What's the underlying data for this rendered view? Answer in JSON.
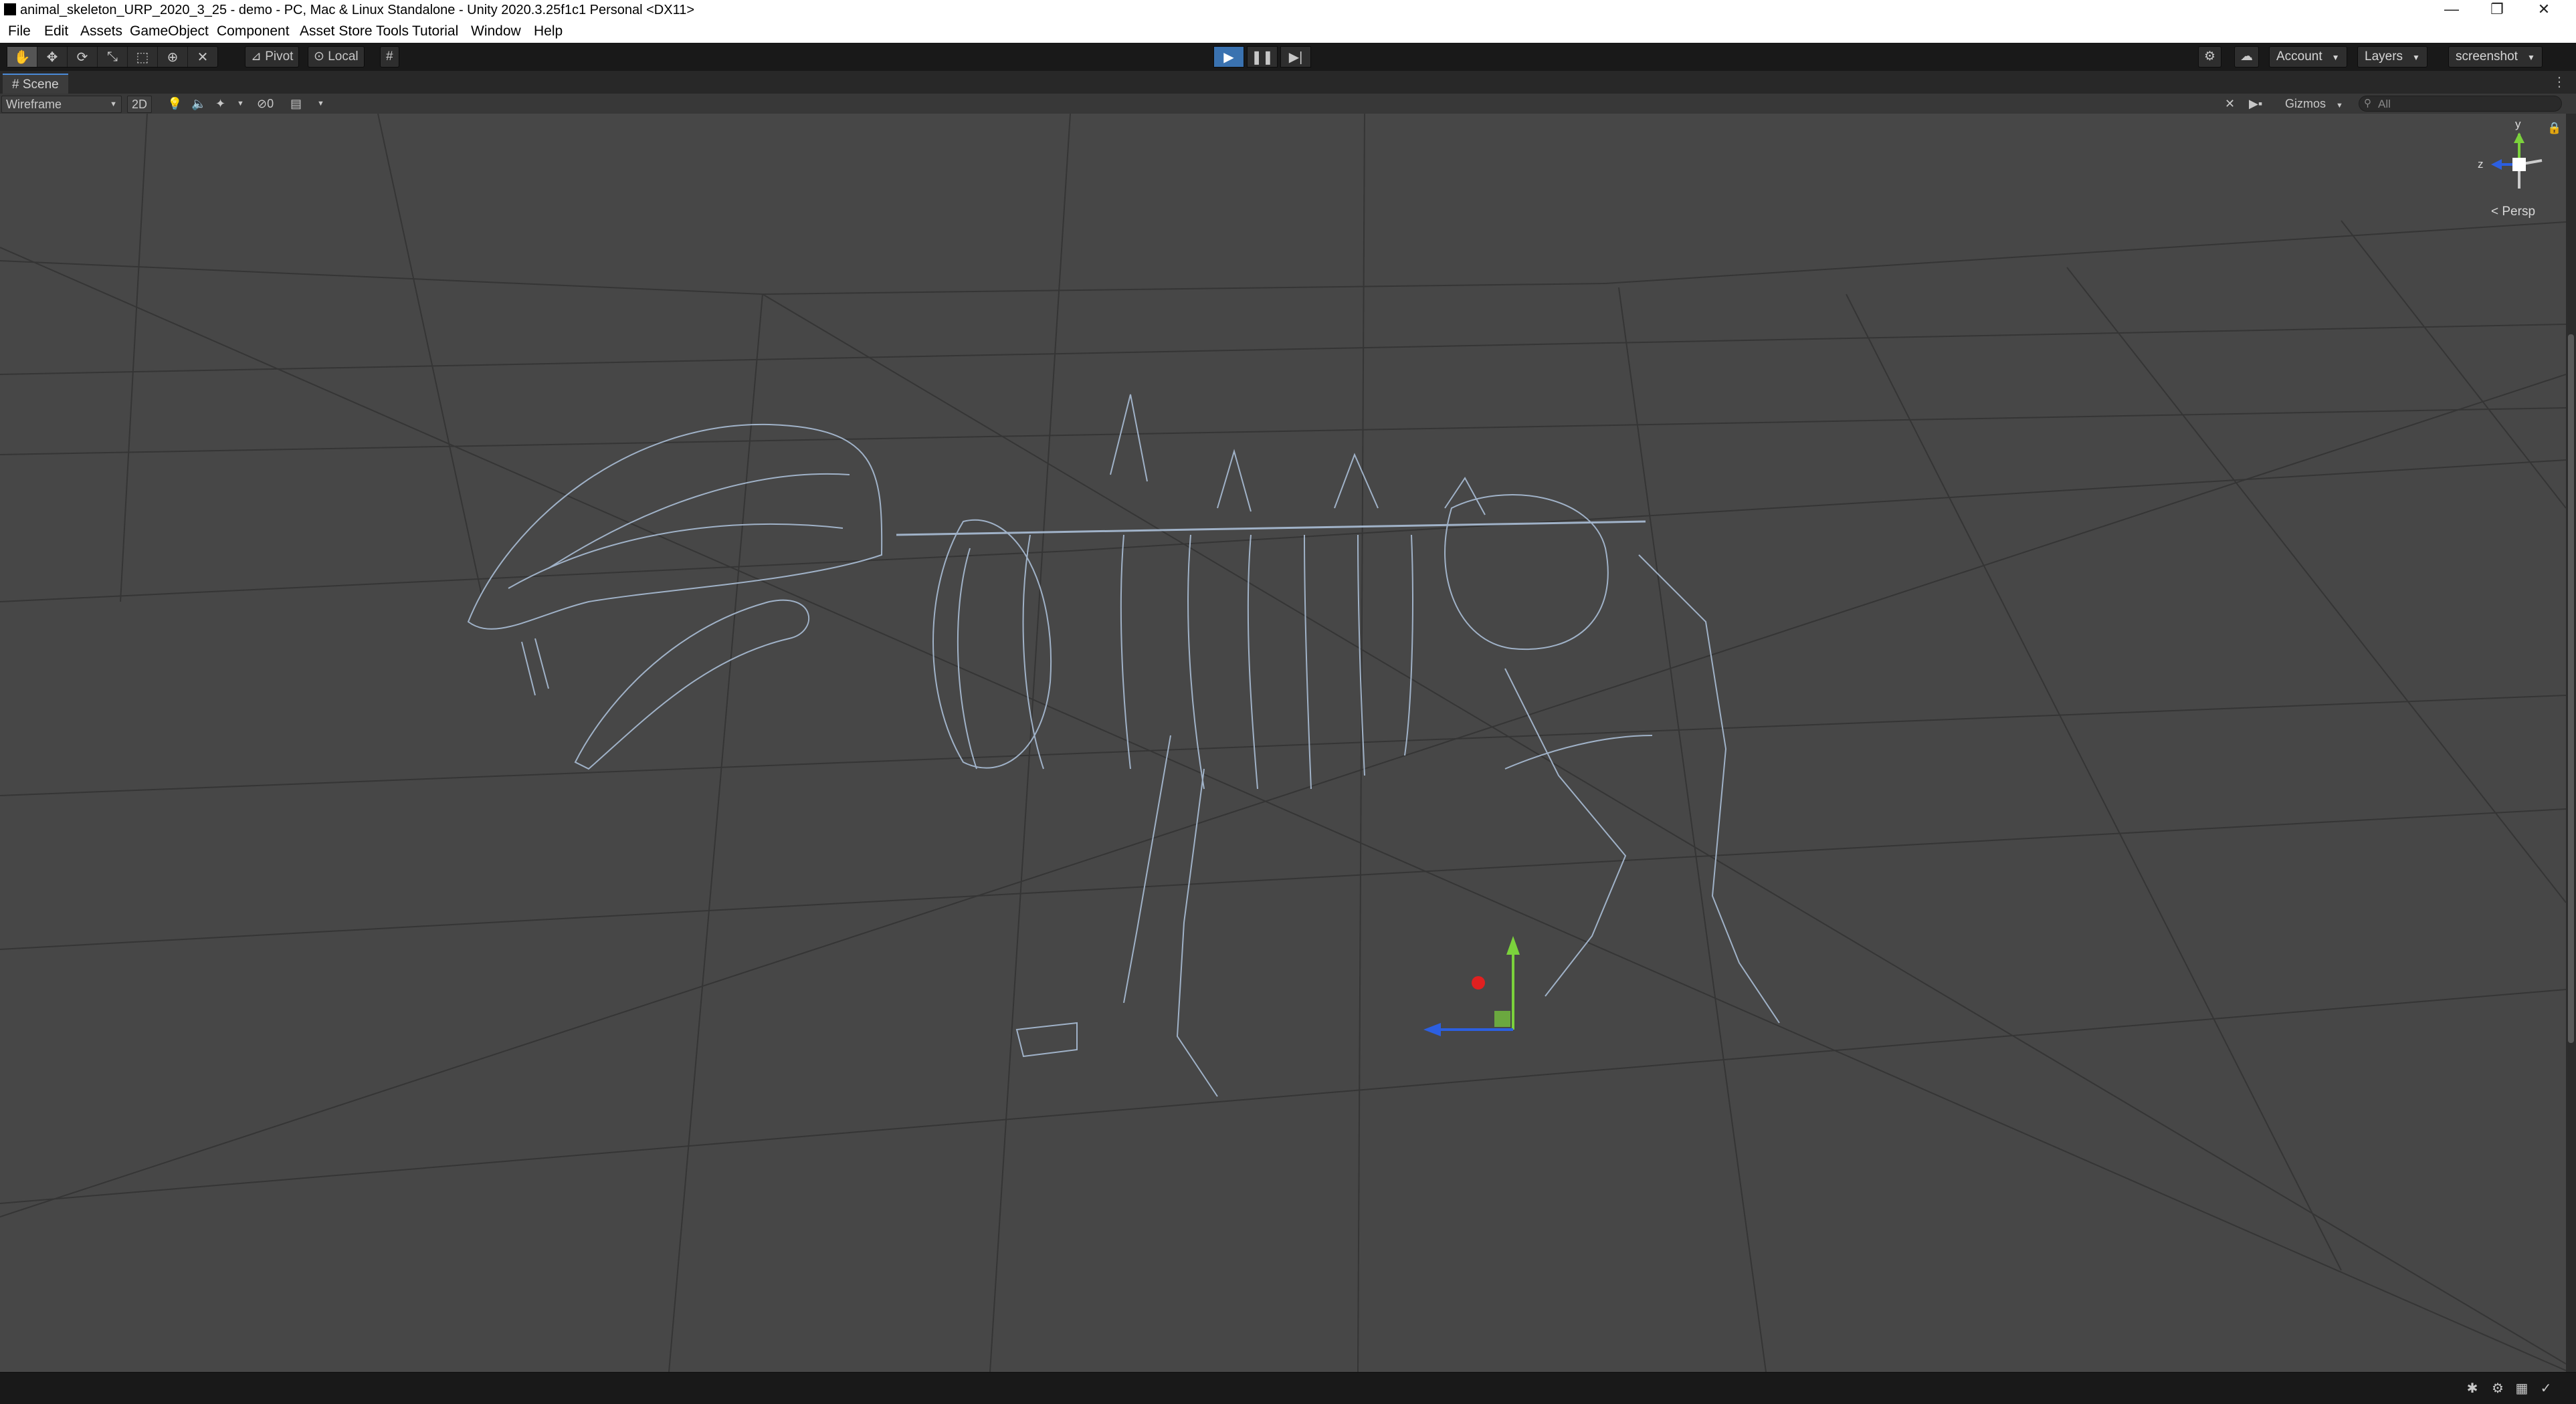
{
  "window": {
    "title": "animal_skeleton_URP_2020_3_25 - demo - PC, Mac & Linux Standalone - Unity 2020.3.25f1c1 Personal <DX11>",
    "minimize": "—",
    "maximize": "❐",
    "close": "✕"
  },
  "menu": {
    "items": [
      "File",
      "Edit",
      "Assets",
      "GameObject",
      "Component",
      "Asset Store Tools",
      "Tutorial",
      "Window",
      "Help"
    ]
  },
  "toolbar": {
    "tools": [
      "hand-tool-icon",
      "move-tool-icon",
      "rotate-tool-icon",
      "scale-tool-icon",
      "rect-tool-icon",
      "transform-tool-icon",
      "custom-tool-icon"
    ],
    "pivot_label": "Pivot",
    "local_label": "Local",
    "play_icon": "▶",
    "pause_icon": "❚❚",
    "step_icon": "▶|",
    "account_label": "Account",
    "layers_label": "Layers",
    "layout_label": "screenshot"
  },
  "scene": {
    "tab_label": "Scene",
    "draw_mode": "Wireframe",
    "mode_2d": "2D",
    "hidden_count": "0",
    "gizmos_label": "Gizmos",
    "search_placeholder": "All",
    "persp_label": "< Persp",
    "axis_y": "y",
    "axis_z": "z"
  },
  "colors": {
    "wire": "#aabed6",
    "grid": "#333333",
    "accent": "#3a72b0",
    "axis_x": "#e02020",
    "axis_y": "#7bd23c",
    "axis_z": "#2c5fe0"
  }
}
